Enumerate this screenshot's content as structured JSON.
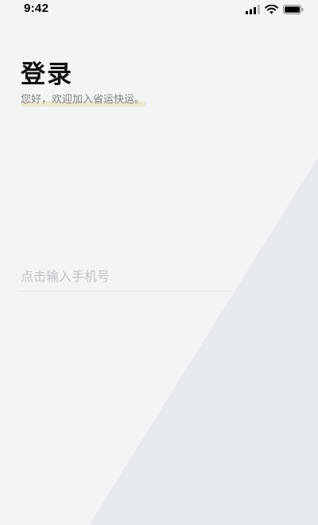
{
  "status_bar": {
    "time": "9:42",
    "icons": [
      "cellular-signal-icon",
      "wifi-icon",
      "battery-icon"
    ]
  },
  "login": {
    "title": "登录",
    "subtitle": "您好，欢迎加入省运快运。"
  },
  "phone_input": {
    "placeholder": "点击输入手机号",
    "value": ""
  },
  "colors": {
    "background": "#f3f4f6",
    "background_shape": "#e6e9ed",
    "title": "#111111",
    "subtitle": "#808080",
    "subtitle_highlight": "#f1e7d3",
    "placeholder": "#bfc3c8",
    "divider": "#e4e6e9"
  }
}
